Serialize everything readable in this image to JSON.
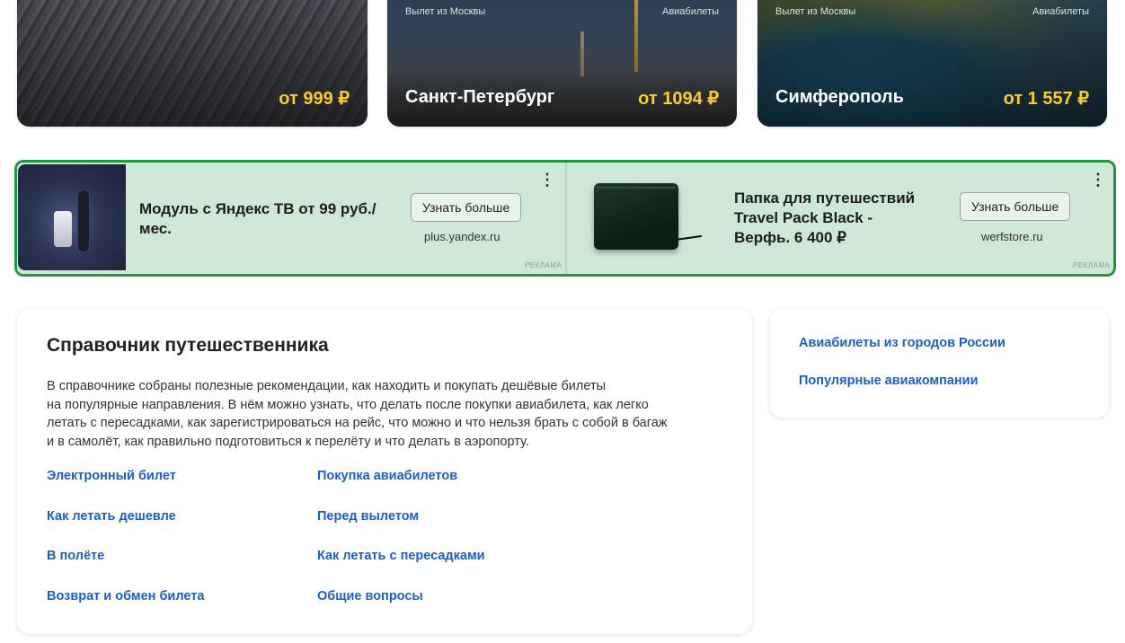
{
  "cards": [
    {
      "departure": "",
      "category": "",
      "city": "",
      "price": "от 999 ₽"
    },
    {
      "departure": "Вылет из Москвы",
      "category": "Авиабилеты",
      "city": "Санкт-Петербург",
      "price": "от 1094 ₽"
    },
    {
      "departure": "Вылет из Москвы",
      "category": "Авиабилеты",
      "city": "Симферополь",
      "price": "от 1 557 ₽"
    }
  ],
  "ads": [
    {
      "title_line1": "Модуль с Яндекс ТВ от 99 руб./",
      "title_line2": "мес.",
      "button": "Узнать больше",
      "domain": "plus.yandex.ru",
      "label": "РЕКЛАМА",
      "menu": "⋮"
    },
    {
      "title_line1": "Папка для путешествий",
      "title_line2": "Travel Pack Black -",
      "title_line3": "Верфь. 6 400 ₽",
      "button": "Узнать больше",
      "domain": "werfstore.ru",
      "label": "РЕКЛАМА",
      "menu": "⋮"
    }
  ],
  "guide": {
    "title": "Справочник путешественника",
    "desc_lines": [
      "В справочнике собраны полезные рекомендации, как находить и покупать дешёвые билеты",
      "на популярные направления. В нём можно узнать, что делать после покупки авиабилета, как легко",
      "летать с пересадками, как зарегистрироваться на рейс, что можно и что нельзя брать с собой в багаж",
      "и в самолёт, как правильно подготовиться к перелёту и что делать в аэропорту."
    ],
    "links_left": [
      "Электронный билет",
      "Как летать дешевле",
      "В полёте",
      "Возврат и обмен билета"
    ],
    "links_right": [
      "Покупка авиабилетов",
      "Перед вылетом",
      "Как летать с пересадками",
      "Общие вопросы"
    ]
  },
  "side": {
    "links": [
      "Авиабилеты из городов России",
      "Популярные авиакомпании"
    ]
  },
  "colors": {
    "price": "#ffcc1f",
    "link": "#1a5fc9",
    "ad_border": "#1e9a3e",
    "ad_bg": "#cfe7d6"
  }
}
